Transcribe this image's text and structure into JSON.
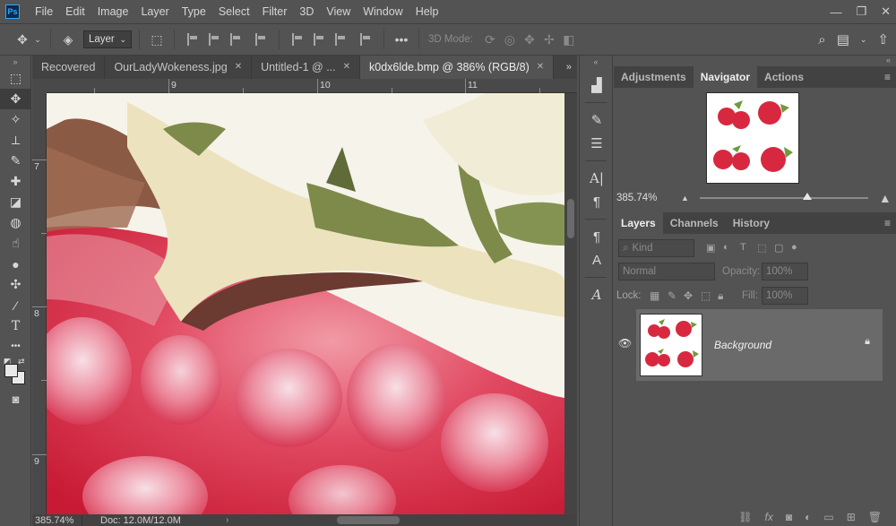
{
  "app": {
    "logo_text": "Ps",
    "menu": [
      "File",
      "Edit",
      "Image",
      "Layer",
      "Type",
      "Select",
      "Filter",
      "3D",
      "View",
      "Window",
      "Help"
    ],
    "window_controls": [
      "minimize-icon",
      "restore-icon",
      "close-icon"
    ]
  },
  "options_bar": {
    "move_tool_icon": "move-icon",
    "auto_select_icon": "auto-select-layers-icon",
    "auto_select_value": "Layer",
    "transform_controls_icon": "transform-controls-icon",
    "more_label": "•••",
    "mode_3d_label": "3D Mode:",
    "right_icons": [
      "search-icon",
      "workspace-icon",
      "share-icon"
    ]
  },
  "toolbar": {
    "collapse": "»",
    "tools": [
      {
        "name": "marquee-tool-icon",
        "glyph": "⬚"
      },
      {
        "name": "move-tool-icon",
        "glyph": "✥"
      },
      {
        "name": "magic-wand-icon",
        "glyph": "✧"
      },
      {
        "name": "crop-tool-icon",
        "glyph": "⟂"
      },
      {
        "name": "brush-tool-icon",
        "glyph": "✎"
      },
      {
        "name": "healing-brush-icon",
        "glyph": "✚"
      },
      {
        "name": "eraser-tool-icon",
        "glyph": "◪"
      },
      {
        "name": "paint-bucket-icon",
        "glyph": "◍"
      },
      {
        "name": "smudge-tool-icon",
        "glyph": "☝"
      },
      {
        "name": "dodge-tool-icon",
        "glyph": "●"
      },
      {
        "name": "puzzle-icon",
        "glyph": "✣"
      },
      {
        "name": "eyedropper-icon",
        "glyph": "⁄"
      },
      {
        "name": "type-tool-icon",
        "glyph": "T"
      },
      {
        "name": "more-tools-icon",
        "glyph": "•••"
      }
    ],
    "quick_mask_icon": "◙"
  },
  "document": {
    "tabs": [
      {
        "label": "Recovered",
        "active": false
      },
      {
        "label": "OurLadyWokeness.jpg",
        "active": false
      },
      {
        "label": "Untitled-1 @ ...",
        "active": false
      },
      {
        "label": "k0dx6lde.bmp @ 386% (RGB/8)",
        "active": true
      }
    ],
    "tab_close": "✕",
    "tabs_more": "»",
    "ruler_top_labels": [
      "9",
      "10",
      "11"
    ],
    "ruler_left_labels": [
      "7",
      "8",
      "9"
    ],
    "status_zoom": "385.74%",
    "status_doc": "Doc: 12.0M/12.0M",
    "status_arrow": "›"
  },
  "icon_strip": {
    "collapse": "«",
    "icons": [
      "histogram-icon",
      "brush-settings-icon",
      "adjust-sliders-icon",
      "character-icon",
      "paragraph-icon",
      "paragraph-styles-icon",
      "character-styles-icon",
      "glyphs-icon"
    ]
  },
  "navigator_panel": {
    "collapse": "«",
    "tabs": [
      "Adjustments",
      "Navigator",
      "Actions"
    ],
    "active_tab": "Navigator",
    "menu": "≡",
    "zoom": "385.74%",
    "zoom_slider_fraction": 0.64
  },
  "layers_panel": {
    "tabs": [
      "Layers",
      "Channels",
      "History"
    ],
    "active_tab": "Layers",
    "menu": "≡",
    "kind_placeholder": "Kind",
    "blend_mode": "Normal",
    "opacity_label": "Opacity:",
    "opacity_value": "100%",
    "lock_label": "Lock:",
    "fill_label": "Fill:",
    "fill_value": "100%",
    "layers": [
      {
        "name": "Background",
        "visible": true,
        "locked": true
      }
    ],
    "footer_icons": [
      "link-layers-icon",
      "fx-icon",
      "add-mask-icon",
      "adjustment-layer-icon",
      "group-icon",
      "new-layer-icon",
      "delete-icon"
    ]
  },
  "colors": {
    "panel_bg": "#535353",
    "tab_bar_bg": "#424242",
    "accent": "#31a8ff",
    "raspberry": "#d8283f",
    "leaf": "#7d8a4a"
  }
}
